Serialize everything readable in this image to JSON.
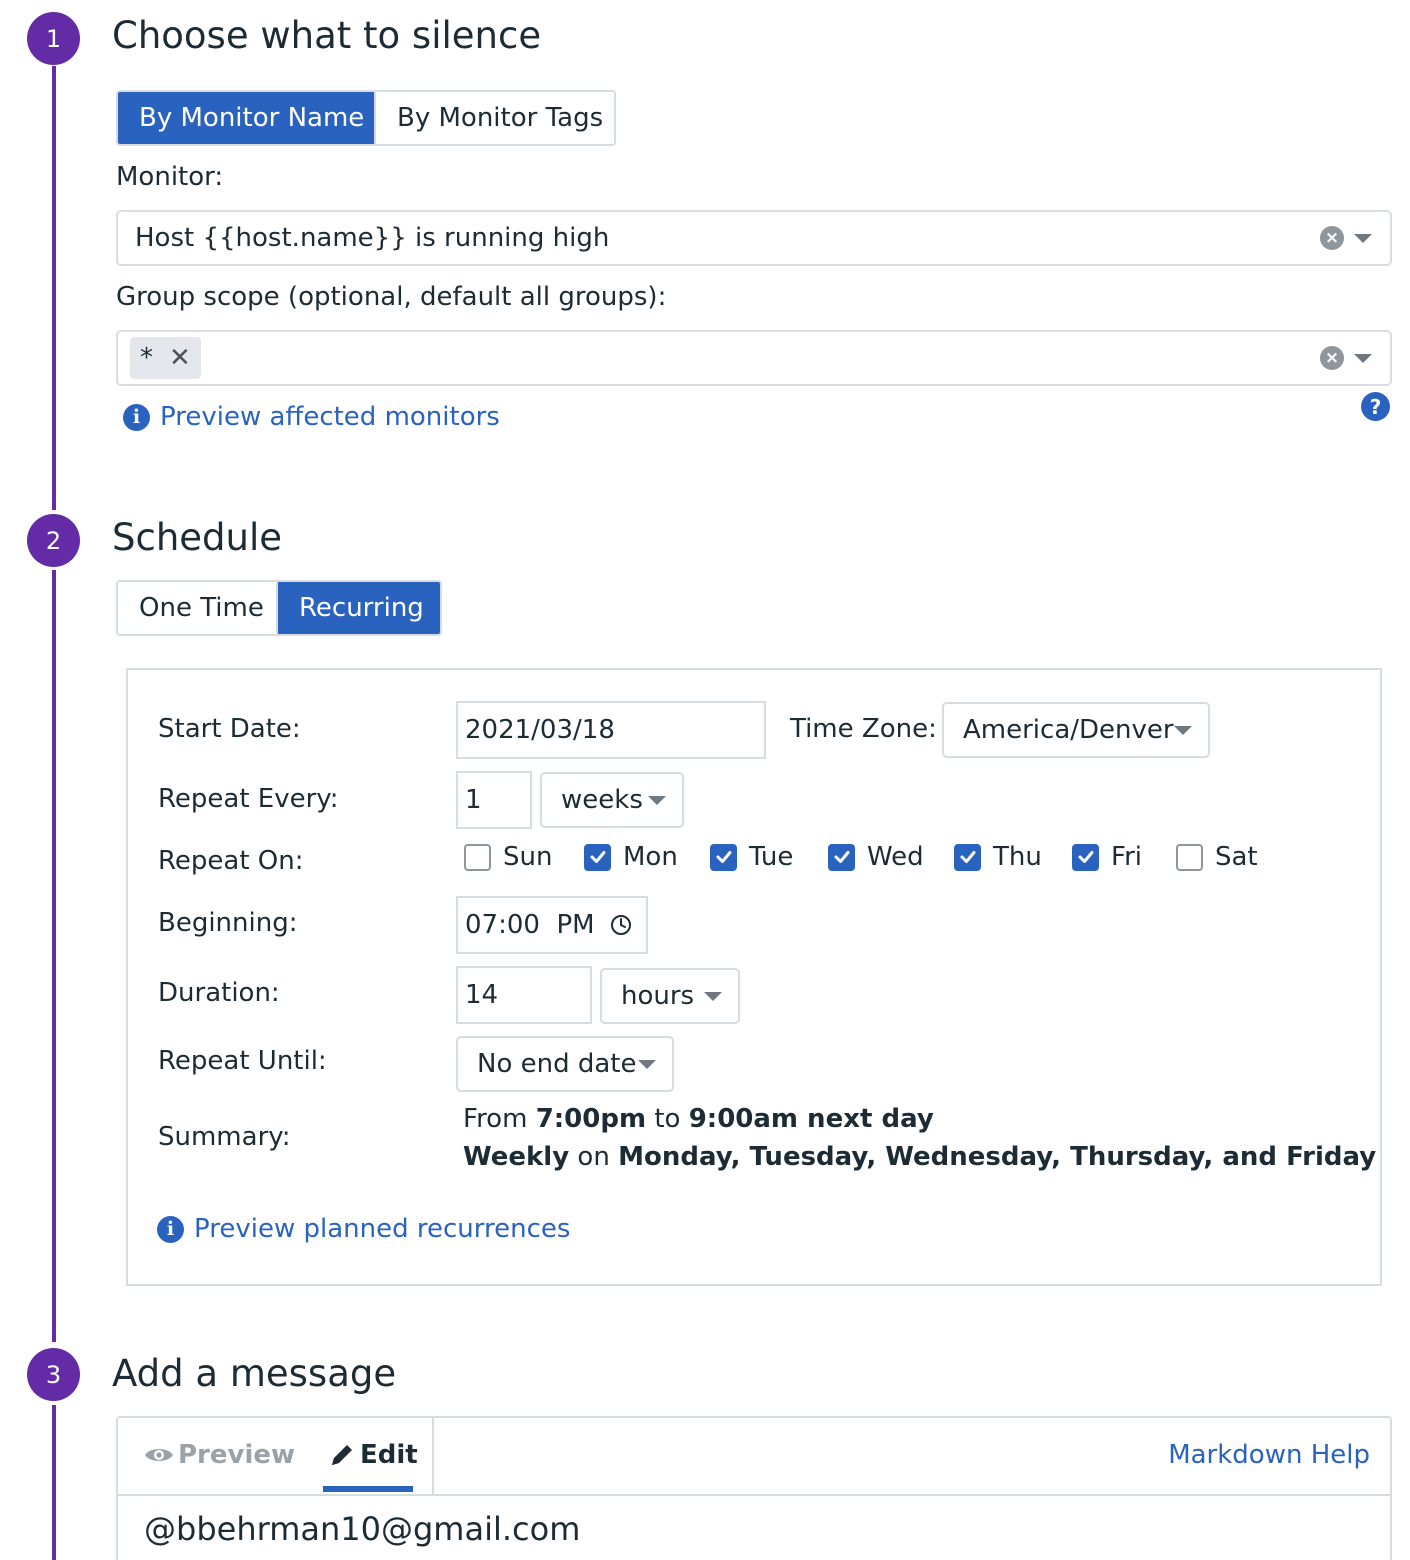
{
  "steps": {
    "s1": {
      "number": "1",
      "title": "Choose what to silence"
    },
    "s2": {
      "number": "2",
      "title": "Schedule"
    },
    "s3": {
      "number": "3",
      "title": "Add a message"
    }
  },
  "silence": {
    "tabs": [
      "By Monitor Name",
      "By Monitor Tags"
    ],
    "active_tab": "By Monitor Name",
    "monitor_label": "Monitor:",
    "monitor_value": "Host {{host.name}} is running high",
    "group_scope_label": "Group scope (optional, default all groups):",
    "group_scope_tag": "*",
    "preview_link": "Preview affected monitors"
  },
  "schedule": {
    "tabs": [
      "One Time",
      "Recurring"
    ],
    "active_tab": "Recurring",
    "start_date_label": "Start Date:",
    "start_date": "2021/03/18",
    "timezone_label": "Time Zone:",
    "timezone": "America/Denver",
    "repeat_every_label": "Repeat Every:",
    "repeat_every_value": "1",
    "repeat_every_unit": "weeks",
    "repeat_on_label": "Repeat On:",
    "days": [
      {
        "label": "Sun",
        "checked": false
      },
      {
        "label": "Mon",
        "checked": true
      },
      {
        "label": "Tue",
        "checked": true
      },
      {
        "label": "Wed",
        "checked": true
      },
      {
        "label": "Thu",
        "checked": true
      },
      {
        "label": "Fri",
        "checked": true
      },
      {
        "label": "Sat",
        "checked": false
      }
    ],
    "beginning_label": "Beginning:",
    "beginning_value": "07:00  PM",
    "duration_label": "Duration:",
    "duration_value": "14",
    "duration_unit": "hours",
    "repeat_until_label": "Repeat Until:",
    "repeat_until_value": "No end date",
    "summary_label": "Summary:",
    "summary": {
      "line1_prefix": "From ",
      "line1_start": "7:00pm",
      "line1_mid": " to ",
      "line1_end": "9:00am next day",
      "line2_freq": "Weekly",
      "line2_mid": " on ",
      "line2_days": "Monday, Tuesday, Wednesday, Thursday, and Friday"
    },
    "preview_link": "Preview planned recurrences"
  },
  "message": {
    "preview_tab": "Preview",
    "edit_tab": "Edit",
    "active_tab": "Edit",
    "markdown_help": "Markdown Help",
    "text": "@bbehrman10@gmail.com"
  },
  "colors": {
    "accent": "#632ca6",
    "primary": "#2a63bf",
    "border": "#d7dce1"
  },
  "icons": [
    "info-icon",
    "help-icon",
    "clear-icon",
    "chevron-down-icon",
    "clock-icon",
    "checkbox-icon",
    "eye-icon",
    "pencil-icon",
    "close-icon"
  ]
}
